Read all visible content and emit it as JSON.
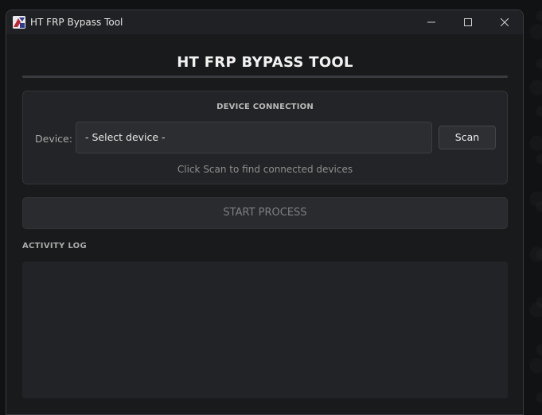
{
  "window": {
    "title": "HT FRP Bypass Tool"
  },
  "app": {
    "heading": "HT FRP BYPASS TOOL"
  },
  "connection": {
    "section_title": "DEVICE CONNECTION",
    "device_label": "Device:",
    "device_selected": "- Select device -",
    "scan_label": "Scan",
    "hint": "Click Scan to find connected devices"
  },
  "actions": {
    "start_label": "START PROCESS",
    "start_enabled": false
  },
  "log": {
    "label": "ACTIVITY LOG",
    "entries": []
  },
  "colors": {
    "background": "#191a1c",
    "card": "#232427",
    "accent_text": "#f2f2f2"
  }
}
